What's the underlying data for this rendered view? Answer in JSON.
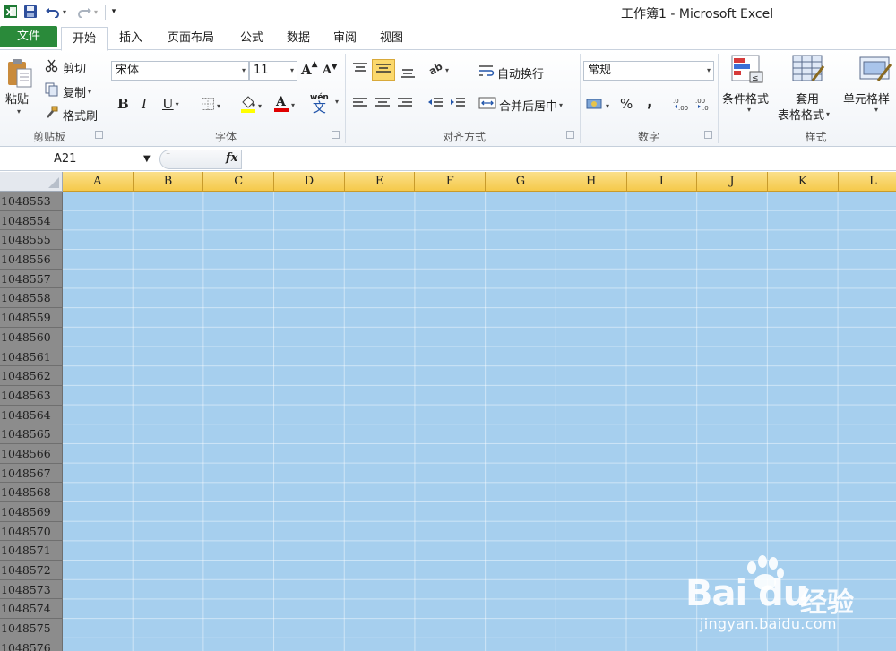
{
  "window": {
    "title": "工作簿1 - Microsoft Excel"
  },
  "tabs": [
    {
      "label": "文件"
    },
    {
      "label": "开始"
    },
    {
      "label": "插入"
    },
    {
      "label": "页面布局"
    },
    {
      "label": "公式"
    },
    {
      "label": "数据"
    },
    {
      "label": "审阅"
    },
    {
      "label": "视图"
    }
  ],
  "ribbon": {
    "clipboard": {
      "label": "剪贴板",
      "paste": "粘贴",
      "cut": "剪切",
      "copy": "复制",
      "format_painter": "格式刷"
    },
    "font": {
      "label": "字体",
      "font_name": "宋体",
      "font_size": "11",
      "bold": "B",
      "italic": "I",
      "underline": "U",
      "grow": "A",
      "shrink": "A",
      "phonetic": "wén",
      "phonetic_char": "文"
    },
    "alignment": {
      "label": "对齐方式",
      "wrap_text": "自动换行",
      "merge_center": "合并后居中"
    },
    "number": {
      "label": "数字",
      "format": "常规",
      "percent": "%",
      "comma": ",",
      "inc_decimal": ".0 .00",
      "dec_decimal": ".00 .0"
    },
    "styles": {
      "label": "样式",
      "conditional_format": "条件格式",
      "format_as_table_1": "套用",
      "format_as_table_2": "表格格式",
      "cell_styles": "单元格样"
    }
  },
  "formula_bar": {
    "name_box": "A21",
    "fx": "fx",
    "value": ""
  },
  "columns": [
    "A",
    "B",
    "C",
    "D",
    "E",
    "F",
    "G",
    "H",
    "I",
    "J",
    "K",
    "L"
  ],
  "rows": [
    "1048553",
    "1048554",
    "1048555",
    "1048556",
    "1048557",
    "1048558",
    "1048559",
    "1048560",
    "1048561",
    "1048562",
    "1048563",
    "1048564",
    "1048565",
    "1048566",
    "1048567",
    "1048568",
    "1048569",
    "1048570",
    "1048571",
    "1048572",
    "1048573",
    "1048574",
    "1048575",
    "1048576"
  ],
  "colors": {
    "selection": "#a6cfee",
    "file_tab": "#2a8a3a",
    "col_header_selected": "#f5c94a",
    "row_header_selected": "#8c8c8c"
  },
  "watermark": {
    "brand": "Bai du",
    "cn": "经验",
    "url": "jingyan.baidu.com"
  }
}
